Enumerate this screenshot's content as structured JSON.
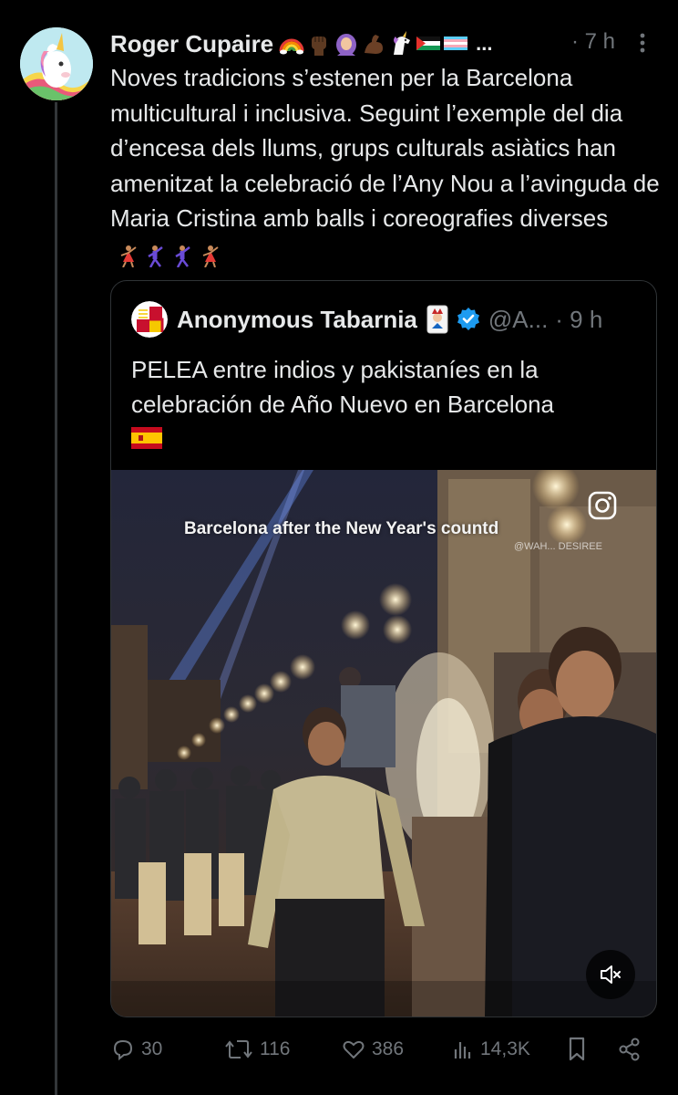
{
  "tweet": {
    "author": {
      "display_name": "Roger Cupaire",
      "emojis": [
        "rainbow-emoji",
        "raised-fist-emoji",
        "woman-headscarf-emoji",
        "flexed-biceps-emoji",
        "unicorn-emoji",
        "palestine-flag-emoji",
        "transgender-flag-emoji"
      ],
      "ellipsis": "..."
    },
    "time": "· 7 h",
    "text": "Noves tradicions s’estenen per la Barcelona multicultural i inclusiva. Seguint l’exemple del dia d’encesa dels llums, grups culturals asiàtics han amenitzat la celebració de l’Any Nou a l’avinguda de Maria Cristina amb balls i coreografies diverses",
    "text_emojis": [
      "dancer-emoji",
      "man-dancing-emoji",
      "man-dancing-emoji",
      "dancer-emoji"
    ]
  },
  "quote": {
    "author": {
      "display_name": "Anonymous Tabarnia",
      "handle": "@A...",
      "badge": "verified-blue",
      "card_emoji": "joker-card-emoji"
    },
    "time": "· 9 h",
    "text": "PELEA entre indios y pakistaníes en la celebración de Año Nuevo en Barcelona",
    "flag": "spain-flag-emoji",
    "video": {
      "caption": "Barcelona after the New Year's countd",
      "watermark": "@WAH... DESIREE",
      "muted": true
    }
  },
  "actions": {
    "replies": "30",
    "reposts": "116",
    "likes": "386",
    "views": "14,3K"
  },
  "colors": {
    "background": "#000000",
    "text_primary": "#e7e9ea",
    "text_secondary": "#71767b",
    "border": "#2f3336",
    "verified": "#1d9bf0"
  }
}
